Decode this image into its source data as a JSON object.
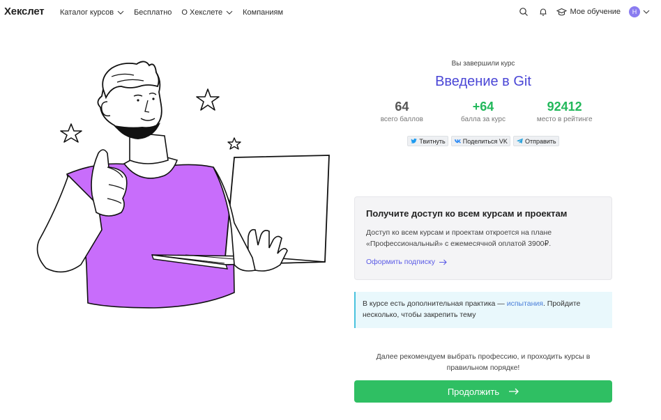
{
  "header": {
    "logo": "Хекслет",
    "nav": [
      {
        "label": "Каталог курсов",
        "dropdown": true
      },
      {
        "label": "Бесплатно",
        "dropdown": false
      },
      {
        "label": "О Хекслете",
        "dropdown": true
      },
      {
        "label": "Компаниям",
        "dropdown": false
      }
    ],
    "icons": [
      "search-icon",
      "bell-icon",
      "graduation-cap-icon"
    ],
    "my_learning": "Мое обучение",
    "avatar_initial": "Н"
  },
  "illustration": {
    "description_icon": "person-with-laptop-thumbs-up",
    "accent_color": "#c86dfb"
  },
  "completion": {
    "label": "Вы завершили курс",
    "course_title": "Введение в Git",
    "stats": [
      {
        "value": "64",
        "label": "всего баллов",
        "highlight": false
      },
      {
        "value": "+64",
        "label": "балла за курс",
        "highlight": true
      },
      {
        "value": "92412",
        "label": "место в рейтинге",
        "highlight": true
      }
    ],
    "share": [
      {
        "label": "Твитнуть",
        "icon": "twitter-icon"
      },
      {
        "label": "Поделиться VK",
        "icon": "vk-icon"
      },
      {
        "label": "Отправить",
        "icon": "telegram-icon"
      }
    ]
  },
  "access": {
    "title": "Получите доступ ко всем курсам и проектам",
    "text_line1": "Доступ ко всем курсам и проектам откроется на плане",
    "text_line2": "«Профессиональный» с ежемесячной оплатой 3900₽.",
    "link": "Оформить подписку"
  },
  "practice": {
    "text_before": "В курсе есть дополнительная практика — ",
    "link": "испытания",
    "text_after": ". Пройдите",
    "text_line2": "несколько, чтобы закрепить тему"
  },
  "recommend": {
    "line1": "Далее рекомендуем выбрать профессию, и проходить курсы в",
    "line2": "правильном порядке!"
  },
  "continue_button": "Продолжить",
  "colors": {
    "title": "#4a46d6",
    "green": "#22b85b",
    "button": "#2fbf63",
    "link": "#5b5be6",
    "accent_purple": "#c86dfb"
  }
}
